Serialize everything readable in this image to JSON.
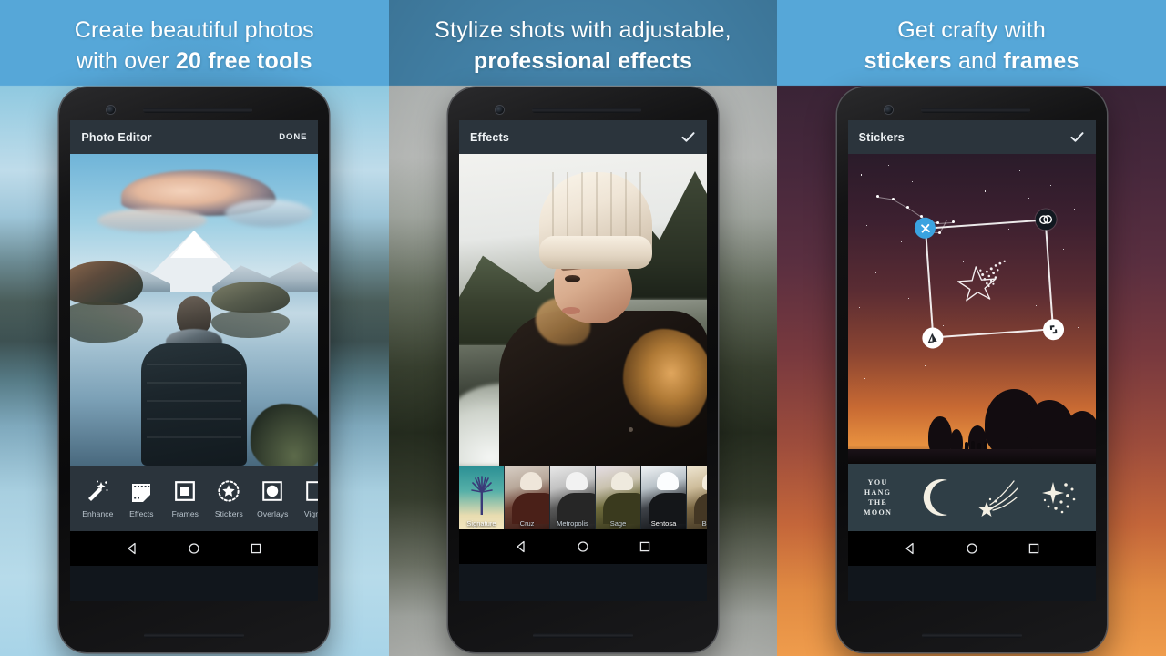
{
  "panels": [
    {
      "id": "panel-photo-editor",
      "headline_line1": "Create beautiful photos",
      "headline_line2_prefix": "with over ",
      "headline_line2_bold": "20 free tools",
      "appbar": {
        "title": "Photo Editor",
        "action_label": "DONE",
        "action_icon": "done-text"
      },
      "toolbar": {
        "items": [
          {
            "label": "Enhance",
            "icon": "magic-wand-icon"
          },
          {
            "label": "Effects",
            "icon": "film-strip-icon"
          },
          {
            "label": "Frames",
            "icon": "square-frame-icon"
          },
          {
            "label": "Stickers",
            "icon": "dashed-star-icon"
          },
          {
            "label": "Overlays",
            "icon": "circle-in-square-icon"
          },
          {
            "label": "Vignett",
            "icon": "vignette-corners-icon"
          }
        ]
      },
      "accent": "#2b343c",
      "background": "blurred-lake-landscape"
    },
    {
      "id": "panel-effects",
      "headline_line1": "Stylize shots with adjustable,",
      "headline_line2_bold": "professional effects",
      "appbar": {
        "title": "Effects",
        "action_label": "",
        "action_icon": "checkmark-icon"
      },
      "filters": {
        "selected": "Sentosa",
        "items": [
          {
            "label": "Signature",
            "selected": false,
            "swatch": "#1d6a73"
          },
          {
            "label": "Cruz",
            "selected": false,
            "swatch": "#5c3a33"
          },
          {
            "label": "Metropolis",
            "selected": false,
            "swatch": "#4a4a4a"
          },
          {
            "label": "Sage",
            "selected": false,
            "swatch": "#4e5238"
          },
          {
            "label": "Sentosa",
            "selected": true,
            "swatch": "#2a2c33"
          },
          {
            "label": "Boar",
            "selected": false,
            "swatch": "#6a5a44"
          }
        ]
      },
      "accent": "#4fb3e8",
      "background": "blurred-snowy-mountain"
    },
    {
      "id": "panel-stickers",
      "headline_line1": "Get crafty with",
      "headline_line2_bold_a": "stickers",
      "headline_line2_mid": " and ",
      "headline_line2_bold_b": "frames",
      "appbar": {
        "title": "Stickers",
        "action_label": "",
        "action_icon": "checkmark-icon"
      },
      "selection_handles": [
        {
          "name": "delete",
          "icon": "close-x-icon",
          "color": "#3aa3e0",
          "position": "top-left"
        },
        {
          "name": "opacity",
          "icon": "opacity-circles-icon",
          "color": "#111820",
          "position": "top-right"
        },
        {
          "name": "flip",
          "icon": "flip-triangle-icon",
          "color": "#ffffff",
          "position": "bottom-left"
        },
        {
          "name": "resize",
          "icon": "resize-rotate-icon",
          "color": "#ffffff",
          "position": "bottom-right"
        }
      ],
      "sticker_tray": {
        "items": [
          {
            "label": "YOU\nHANG\nTHE\nMOON",
            "icon": "text-sticker-you-hang-the-moon"
          },
          {
            "label": "",
            "icon": "crescent-moon-sticker"
          },
          {
            "label": "",
            "icon": "shooting-star-sticker"
          },
          {
            "label": "",
            "icon": "sparkle-stars-sticker"
          }
        ]
      },
      "accent": "#3aa3e0",
      "background": "sunset-gradient"
    }
  ],
  "navbar": {
    "items": [
      {
        "name": "back",
        "icon": "back-triangle-icon"
      },
      {
        "name": "home",
        "icon": "home-circle-icon"
      },
      {
        "name": "recents",
        "icon": "recents-square-icon"
      }
    ]
  },
  "headline_band_color": "#56a7d8"
}
